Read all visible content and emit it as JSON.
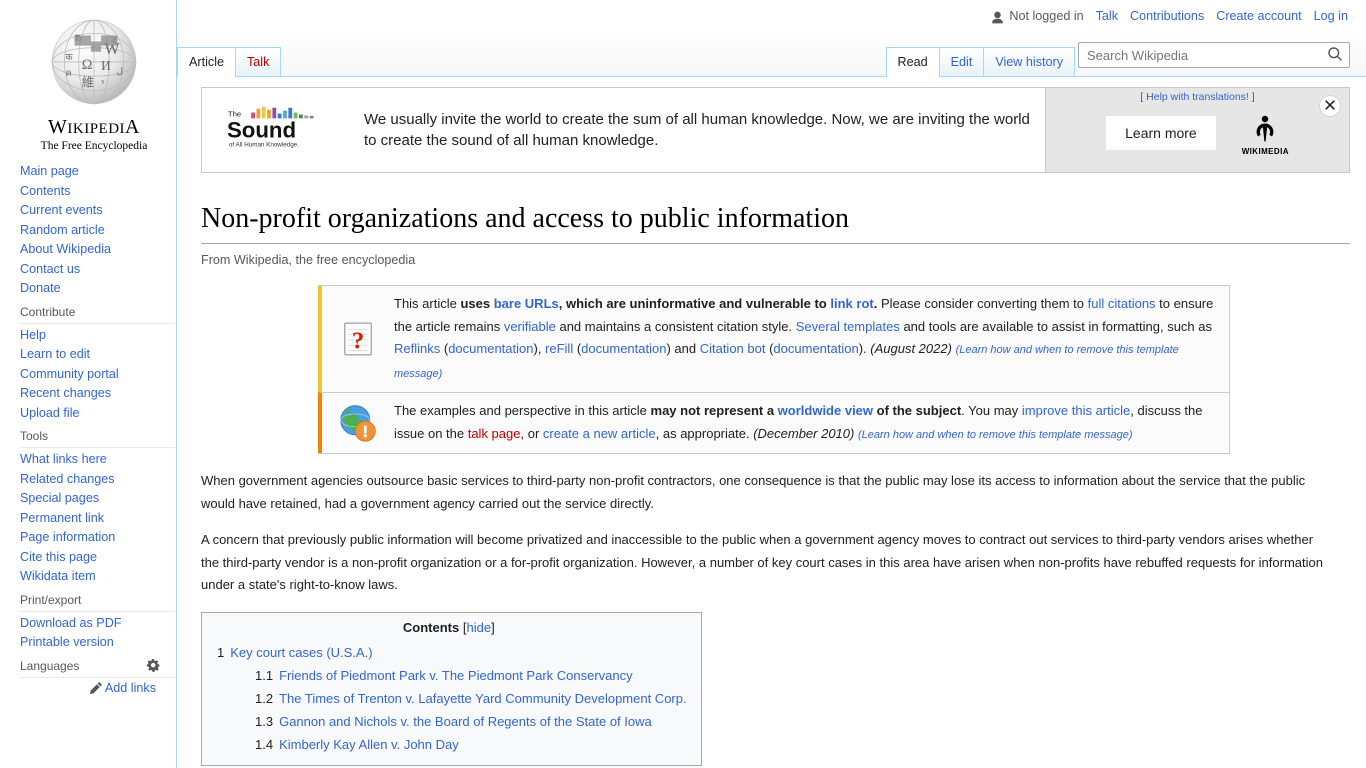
{
  "personal_bar": {
    "user_status": "Not logged in",
    "user_icon": "user-icon",
    "links": [
      "Talk",
      "Contributions",
      "Create account",
      "Log in"
    ]
  },
  "logo": {
    "globe_icon": "wikipedia-globe-icon",
    "wordmark_w": "W",
    "wordmark_rest": "IKIPEDI",
    "wordmark_a": "A",
    "tagline": "The Free Encyclopedia"
  },
  "sidebar": {
    "portals": [
      {
        "heading": "",
        "items": [
          "Main page",
          "Contents",
          "Current events",
          "Random article",
          "About Wikipedia",
          "Contact us",
          "Donate"
        ]
      },
      {
        "heading": "Contribute",
        "items": [
          "Help",
          "Learn to edit",
          "Community portal",
          "Recent changes",
          "Upload file"
        ]
      },
      {
        "heading": "Tools",
        "items": [
          "What links here",
          "Related changes",
          "Special pages",
          "Permanent link",
          "Page information",
          "Cite this page",
          "Wikidata item"
        ]
      },
      {
        "heading": "Print/export",
        "items": [
          "Download as PDF",
          "Printable version"
        ]
      }
    ],
    "languages": {
      "heading": "Languages",
      "gear_icon": "gear-icon",
      "pencil_icon": "pencil-icon",
      "add_links": "Add links"
    }
  },
  "tabs": {
    "namespace": [
      {
        "label": "Article",
        "selected": true,
        "red": false
      },
      {
        "label": "Talk",
        "selected": false,
        "red": true
      }
    ],
    "views": [
      {
        "label": "Read",
        "selected": true
      },
      {
        "label": "Edit",
        "selected": false
      },
      {
        "label": "View history",
        "selected": false
      }
    ]
  },
  "search": {
    "placeholder": "Search Wikipedia",
    "value": "",
    "icon": "search-icon"
  },
  "sitenotice": {
    "logo_line1": "The",
    "logo_main": "Sound",
    "logo_sub": "of All Human Knowledge.",
    "logo_bar_colors": [
      "#d94b7e",
      "#e8a33d",
      "#f2c744",
      "#e8a33d",
      "#8c4fb0",
      "#3b7bbf",
      "#5aa7d9",
      "#3b7bbf",
      "#7bb661",
      "#4d8c4d",
      "#a0a0a0",
      "#7a7a7a"
    ],
    "message": "We usually invite the world to create the sum of all human knowledge. Now, we are inviting the world to create the sound of all human knowledge.",
    "help_translations_open": "[",
    "help_translations_link": "Help with translations!",
    "help_translations_close": "]",
    "learn_more": "Learn more",
    "wikimedia_label": "WIKIMEDIA",
    "wikimedia_icon": "wikimedia-logo-icon",
    "close_icon": "close-icon"
  },
  "article": {
    "title": "Non-profit organizations and access to public information",
    "subtitle": "From Wikipedia, the free encyclopedia",
    "paragraph_1": "When government agencies outsource basic services to third-party non-profit contractors, one consequence is that the public may lose its access to information about the service that the public would have retained, had a government agency carried out the service directly.",
    "paragraph_2": "A concern that previously public information will become privatized and inaccessible to the public when a government agency moves to contract out services to third-party vendors arises whether the third-party vendor is a non-profit organization or a for-profit organization. However, a number of key court cases in this area have arisen when non-profits have rebuffed requests for information under a state's right-to-know laws."
  },
  "ambox_bare_urls": {
    "icon": "question-mark-page-icon",
    "border_color": "#f4c430",
    "t1": "This article ",
    "b1": "uses ",
    "l1": "bare URLs",
    "b2": ", which are uninformative and vulnerable to ",
    "l2": "link rot",
    "b3": ".",
    "t2": " Please consider converting them to ",
    "l3": "full citations",
    "t3": " to ensure the article remains ",
    "l4": "verifiable",
    "t4": " and maintains a consistent citation style. ",
    "l5": "Several templates",
    "t5": " and tools are available to assist in formatting, such as ",
    "l6": "Reflinks",
    "t6": " (",
    "l7": "documentation",
    "t7": "), ",
    "l8": "reFill",
    "t8": " (",
    "l9": "documentation",
    "t9": ") and ",
    "l10": "Citation bot",
    "t10": " (",
    "l11": "documentation",
    "t11": "). ",
    "date": "(August 2022)",
    "learn_more": "(Learn how and when to remove this template message)"
  },
  "ambox_worldwide": {
    "icon": "globe-warning-icon",
    "border_color": "#f28500",
    "t1": "The examples and perspective in this article ",
    "b1": "may not represent a ",
    "l1": "worldwide view",
    "b2": " of the subject",
    "t2": ". You may ",
    "l2": "improve this article",
    "t3": ", discuss the issue on the ",
    "l3": "talk page",
    "t4": ", or ",
    "l4": "create a new article",
    "t5": ", as appropriate. ",
    "date": "(December 2010)",
    "learn_more": "(Learn how and when to remove this template message)"
  },
  "toc": {
    "title": "Contents",
    "toggle_open": "[",
    "toggle_label": "hide",
    "toggle_close": "]",
    "entries": [
      {
        "number": "1",
        "text": "Key court cases (U.S.A.)",
        "level": 1
      },
      {
        "number": "1.1",
        "text": "Friends of Piedmont Park v. The Piedmont Park Conservancy",
        "level": 2
      },
      {
        "number": "1.2",
        "text": "The Times of Trenton v. Lafayette Yard Community Development Corp.",
        "level": 2
      },
      {
        "number": "1.3",
        "text": "Gannon and Nichols v. the Board of Regents of the State of Iowa",
        "level": 2
      },
      {
        "number": "1.4",
        "text": "Kimberly Kay Allen v. John Day",
        "level": 2
      }
    ]
  },
  "colors": {
    "link": "#3366cc",
    "redlink": "#ba0000",
    "tab_border": "#a7d7f9",
    "text": "#202122"
  }
}
